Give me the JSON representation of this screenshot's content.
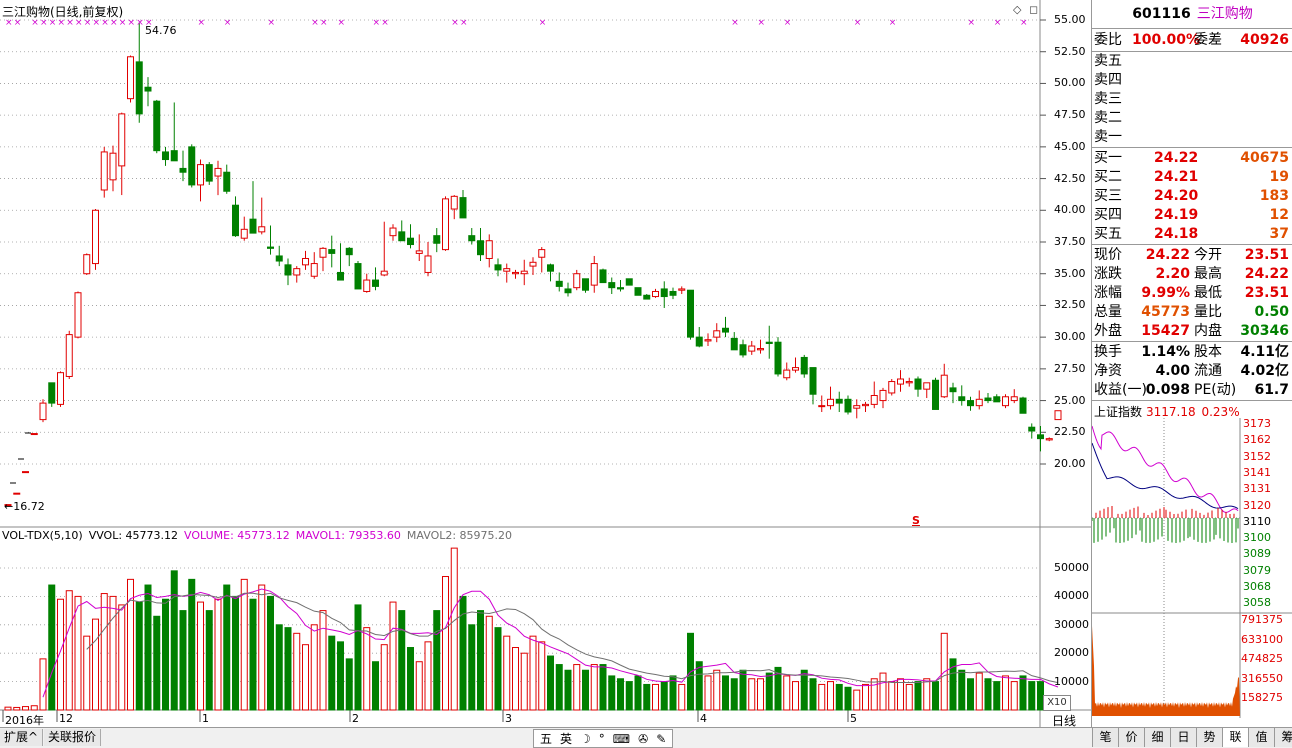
{
  "chart": {
    "title": "三江购物(日线,前复权)",
    "high_label": "54.76",
    "low_label": "16.72",
    "y_ticks": [
      "55.00",
      "52.50",
      "50.00",
      "47.50",
      "45.00",
      "42.50",
      "40.00",
      "37.50",
      "35.00",
      "32.50",
      "30.00",
      "27.50",
      "25.00",
      "22.50",
      "20.00"
    ],
    "x_labels": [
      "2016年",
      "12",
      "1",
      "2",
      "3",
      "4",
      "5"
    ],
    "s_mark": "S",
    "period": "日线",
    "x10_label": "X10"
  },
  "volume_indicator": {
    "name": "VOL-TDX(5,10)",
    "vvol": "VVOL: 45773.12",
    "volume": "VOLUME: 45773.12",
    "mavol1": "MAVOL1: 79353.60",
    "mavol2": "MAVOL2: 85975.20",
    "y_ticks": [
      "50000",
      "40000",
      "30000",
      "20000",
      "10000"
    ]
  },
  "quote": {
    "code": "601116",
    "name": "三江购物",
    "weibi_label": "委比",
    "weibi_value": "100.00%",
    "weicha_label": "委差",
    "weicha_value": "40926",
    "sell": [
      {
        "label": "卖五",
        "price": "",
        "vol": ""
      },
      {
        "label": "卖四",
        "price": "",
        "vol": ""
      },
      {
        "label": "卖三",
        "price": "",
        "vol": ""
      },
      {
        "label": "卖二",
        "price": "",
        "vol": ""
      },
      {
        "label": "卖一",
        "price": "",
        "vol": ""
      }
    ],
    "buy": [
      {
        "label": "买一",
        "price": "24.22",
        "vol": "40675"
      },
      {
        "label": "买二",
        "price": "24.21",
        "vol": "19"
      },
      {
        "label": "买三",
        "price": "24.20",
        "vol": "183"
      },
      {
        "label": "买四",
        "price": "24.19",
        "vol": "12"
      },
      {
        "label": "买五",
        "price": "24.18",
        "vol": "37"
      }
    ],
    "stats1": [
      {
        "l1": "现价",
        "v1": "24.22",
        "l2": "今开",
        "v2": "23.51",
        "c1": "red",
        "c2": "red"
      },
      {
        "l1": "涨跌",
        "v1": "2.20",
        "l2": "最高",
        "v2": "24.22",
        "c1": "red",
        "c2": "red"
      },
      {
        "l1": "涨幅",
        "v1": "9.99%",
        "l2": "最低",
        "v2": "23.51",
        "c1": "red",
        "c2": "red"
      },
      {
        "l1": "总量",
        "v1": "45773",
        "l2": "量比",
        "v2": "0.50",
        "c1": "orn",
        "c2": "grn"
      },
      {
        "l1": "外盘",
        "v1": "15427",
        "l2": "内盘",
        "v2": "30346",
        "c1": "red",
        "c2": "grn"
      }
    ],
    "stats2": [
      {
        "l1": "换手",
        "v1": "1.14%",
        "l2": "股本",
        "v2": "4.11亿"
      },
      {
        "l1": "净资",
        "v1": "4.00",
        "l2": "流通",
        "v2": "4.02亿"
      },
      {
        "l1": "收益(一)",
        "v1": "0.098",
        "l2": "PE(动)",
        "v2": "61.7"
      }
    ]
  },
  "index_mini": {
    "name": "上证指数",
    "value": "3117.18",
    "change": "0.23%",
    "price_ticks": [
      "3173",
      "3162",
      "3152",
      "3141",
      "3131",
      "3120",
      "3110",
      "3100",
      "3089",
      "3079",
      "3068",
      "3058"
    ],
    "vol_ticks": [
      "791375",
      "633100",
      "474825",
      "316550",
      "158275"
    ]
  },
  "bottom_tabs": [
    "扩展^",
    "关联报价"
  ],
  "ime": [
    "五",
    "英"
  ],
  "right_tabs": [
    "笔",
    "价",
    "细",
    "日",
    "势",
    "联",
    "值",
    "筹"
  ],
  "right_tab_active": "联",
  "colors": {
    "up": "#e00000",
    "down": "#008000",
    "ma1": "#d000d0",
    "ma2": "#707070",
    "grid": "#9a9a9a"
  }
}
